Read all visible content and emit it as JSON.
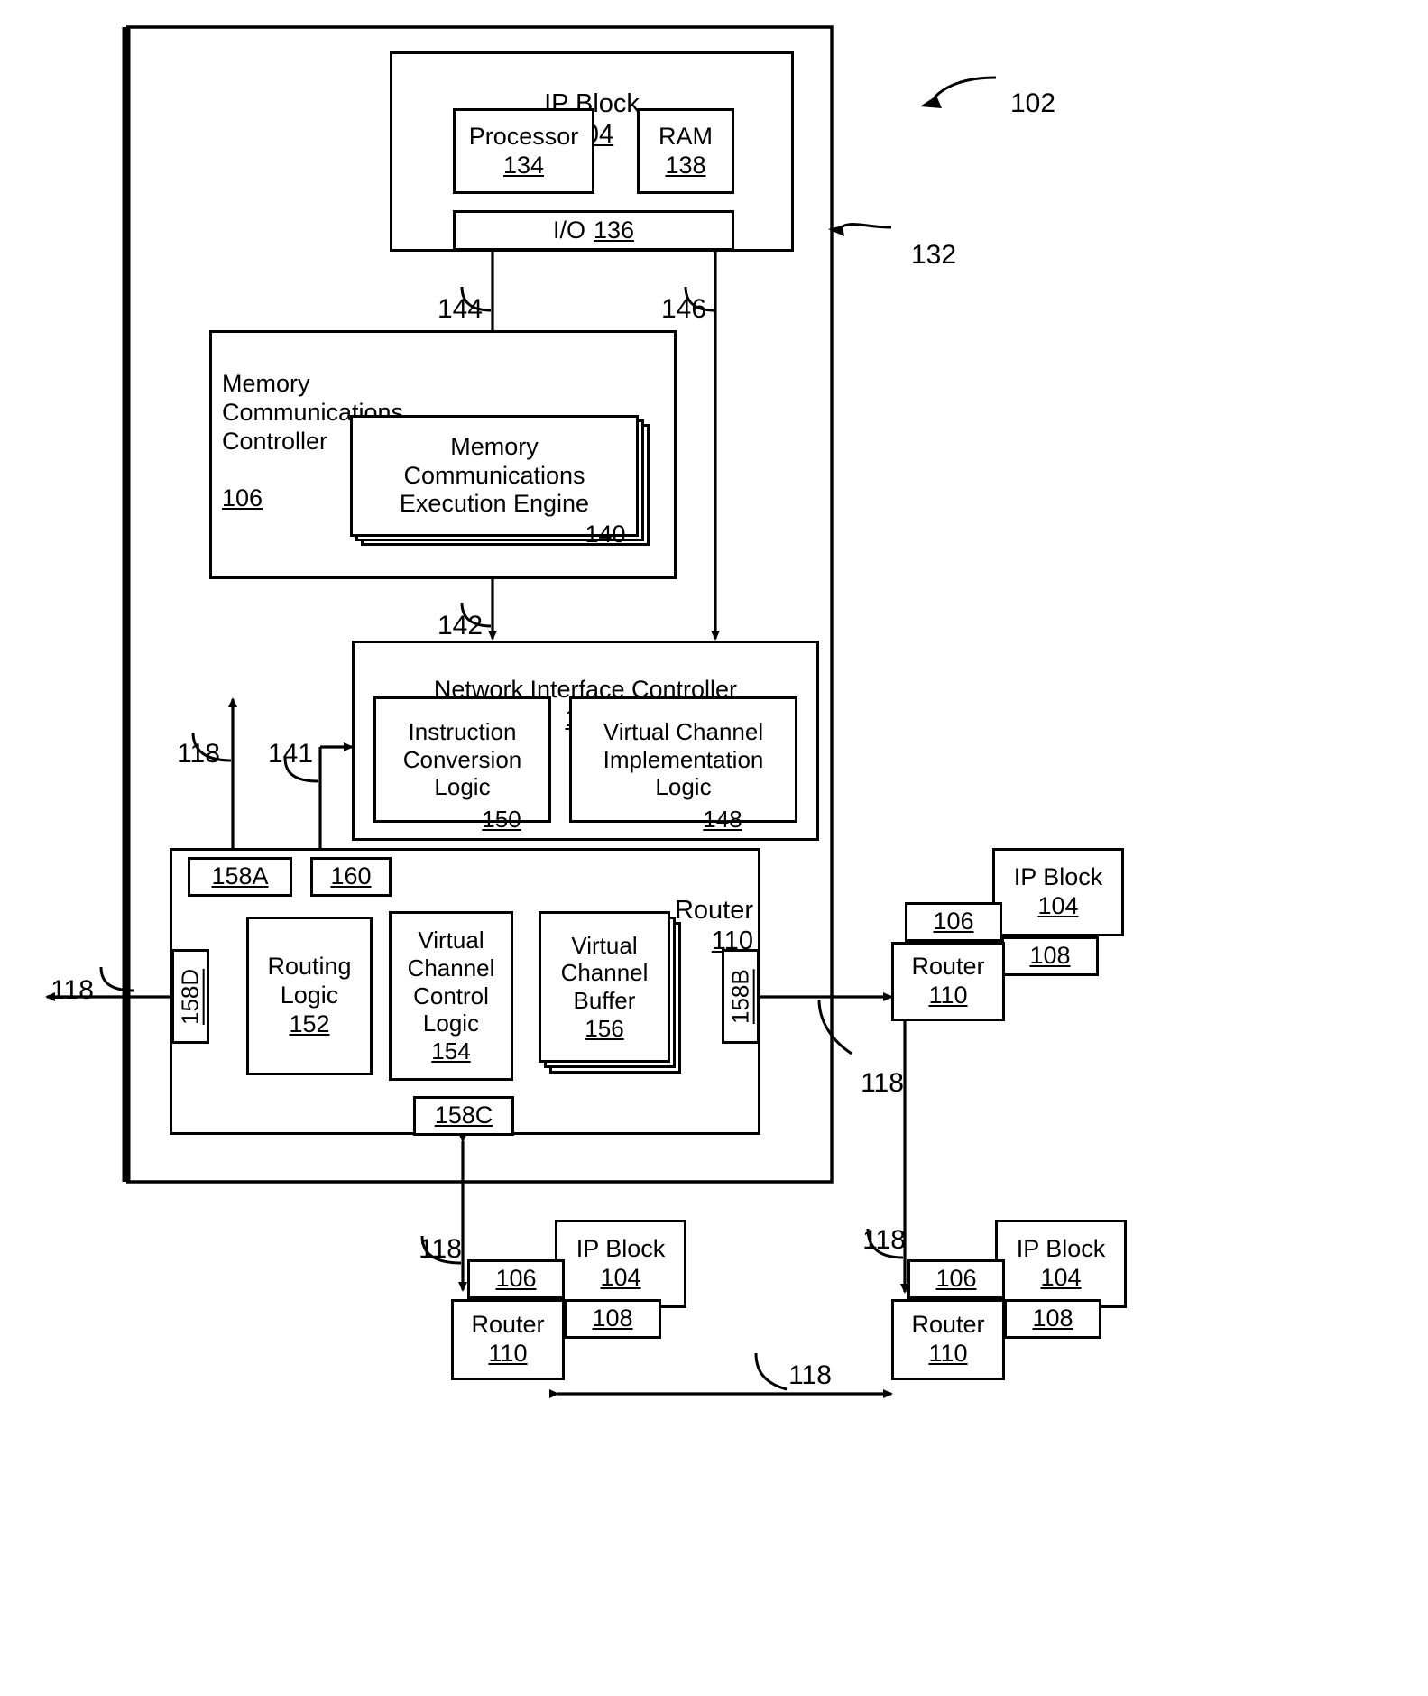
{
  "figure": {
    "ref_main": "102",
    "ref_chip_edge": "132",
    "refs": {
      "r118": "118",
      "r141": "141",
      "r142": "142",
      "r144": "144",
      "r146": "146"
    }
  },
  "ip_block": {
    "title": "IP Block",
    "title_ref": "104",
    "processor": {
      "label": "Processor",
      "ref": "134"
    },
    "ram": {
      "label": "RAM",
      "ref": "138"
    },
    "io": {
      "label": "I/O",
      "ref": "136"
    }
  },
  "memory_controller": {
    "title": "Memory\nCommunications\nController",
    "title_ref": "106",
    "engine": {
      "label": "Memory\nCommunications\nExecution Engine",
      "ref": "140"
    }
  },
  "nic": {
    "title": "Network Interface Controller",
    "title_ref": "108",
    "instruction_conversion": {
      "label": "Instruction\nConversion\nLogic",
      "ref": "150"
    },
    "virtual_channel_impl": {
      "label": "Virtual Channel\nImplementation\nLogic",
      "ref": "148"
    }
  },
  "router": {
    "title": "Router",
    "title_ref": "110",
    "ports": {
      "north": "158A",
      "east": "158B",
      "south": "158C",
      "west": "158D",
      "extra": "160"
    },
    "routing_logic": {
      "label": "Routing\nLogic",
      "ref": "152"
    },
    "vc_control_logic": {
      "label": "Virtual\nChannel\nControl\nLogic",
      "ref": "154"
    },
    "vc_buffer": {
      "label": "Virtual\nChannel\nBuffer",
      "ref": "156"
    }
  },
  "neighbors": [
    {
      "name": "right-cluster",
      "ip_block": "IP Block",
      "ip_block_ref": "104",
      "mcc_ref": "106",
      "nic_ref": "108",
      "router": "Router",
      "router_ref": "110"
    },
    {
      "name": "bottom-left-cluster",
      "ip_block": "IP Block",
      "ip_block_ref": "104",
      "mcc_ref": "106",
      "nic_ref": "108",
      "router": "Router",
      "router_ref": "110"
    },
    {
      "name": "bottom-right-cluster",
      "ip_block": "IP Block",
      "ip_block_ref": "104",
      "mcc_ref": "106",
      "nic_ref": "108",
      "router": "Router",
      "router_ref": "110"
    }
  ],
  "link_labels": {
    "left_118": "118",
    "nic_up_118": "118",
    "right_118": "118",
    "bottom_left_118": "118",
    "bottom_mid_118": "118",
    "bottom_right_118": "118"
  },
  "colors": {
    "stroke": "#000000",
    "background": "#ffffff"
  }
}
